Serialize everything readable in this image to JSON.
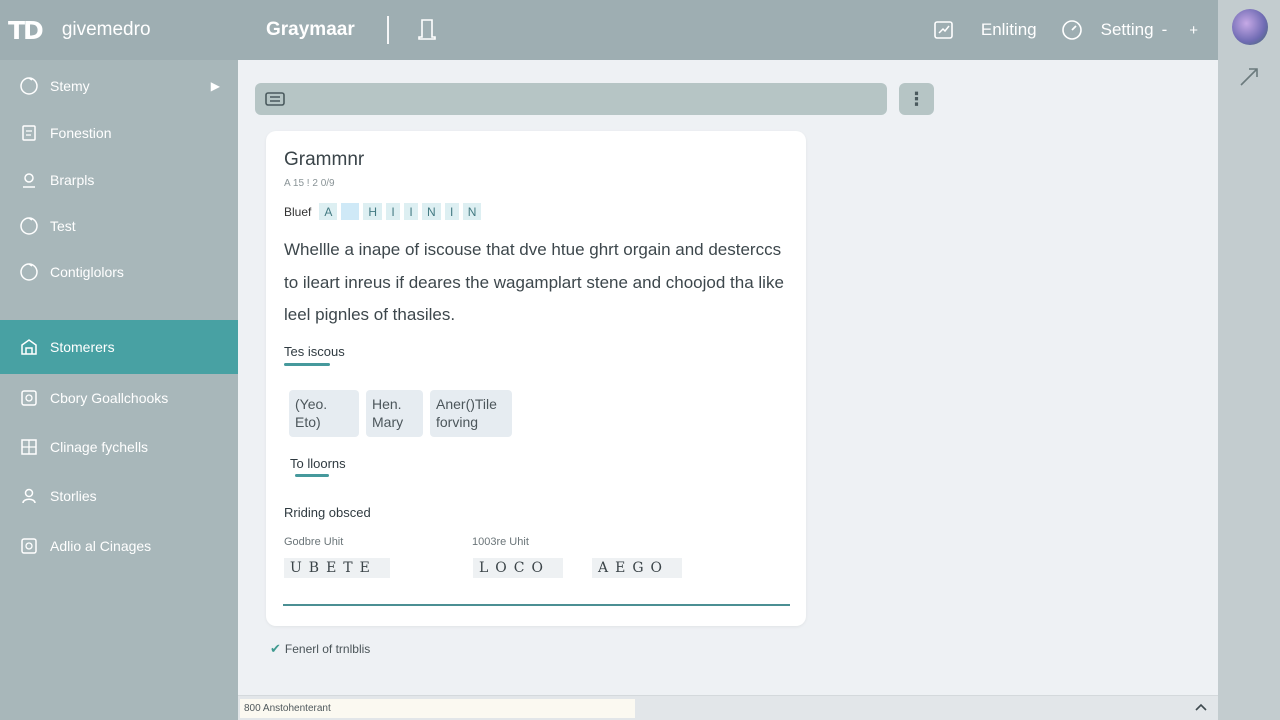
{
  "header": {
    "logo": "TD",
    "brand": "givemedro",
    "app_title": "Graymaar",
    "editing_label": "Enliting",
    "setting_label": "Setting",
    "setting_caret": "-",
    "plus": "+"
  },
  "sidebar": {
    "items": [
      {
        "label": "Stemy",
        "icon": "refresh-icon"
      },
      {
        "label": "Fonestion",
        "icon": "document-icon"
      },
      {
        "label": "Brarpls",
        "icon": "location-icon"
      },
      {
        "label": "Test",
        "icon": "refresh-icon"
      },
      {
        "label": "Contiglolors",
        "icon": "refresh-icon"
      },
      {
        "label": "Stomerers",
        "icon": "store-icon",
        "active": true
      },
      {
        "label": "Cbory Goallchooks",
        "icon": "image-icon"
      },
      {
        "label": "Clinage fychells",
        "icon": "grid-icon"
      },
      {
        "label": "Storlies",
        "icon": "person-icon"
      },
      {
        "label": "Adlio al Cinages",
        "icon": "image-icon"
      }
    ],
    "active_color": "#48a1a3"
  },
  "card": {
    "title": "Grammnr",
    "meta": "A 15 ! 2 0/9",
    "toolbar_label": "Bluef",
    "chips": [
      "A",
      "",
      "H",
      "I",
      "I",
      "N",
      "I",
      "N"
    ],
    "paragraph": "Whellle a inape of iscouse that dve htue ghrt orgain and destercсs to ileart inreus if deares the wagamplart stene and choojod tha like leel pignles of thasiles.",
    "section1": "Tes iscous",
    "tags": [
      "(Yeo. Eto)",
      "Hen. Mary",
      "Aner()Tile forving"
    ],
    "section2": "To lloorns",
    "section3": "Rriding obsced",
    "unit1_label": "Godbre Uhit",
    "unit2_label": "1003re Uhit",
    "code1": "UBETE",
    "code2": "LOCO",
    "code3": "AEGO"
  },
  "footer_check": "Fenerl of trnlblis",
  "status_text": "800 Anstohenterant",
  "accent": "#46999c"
}
